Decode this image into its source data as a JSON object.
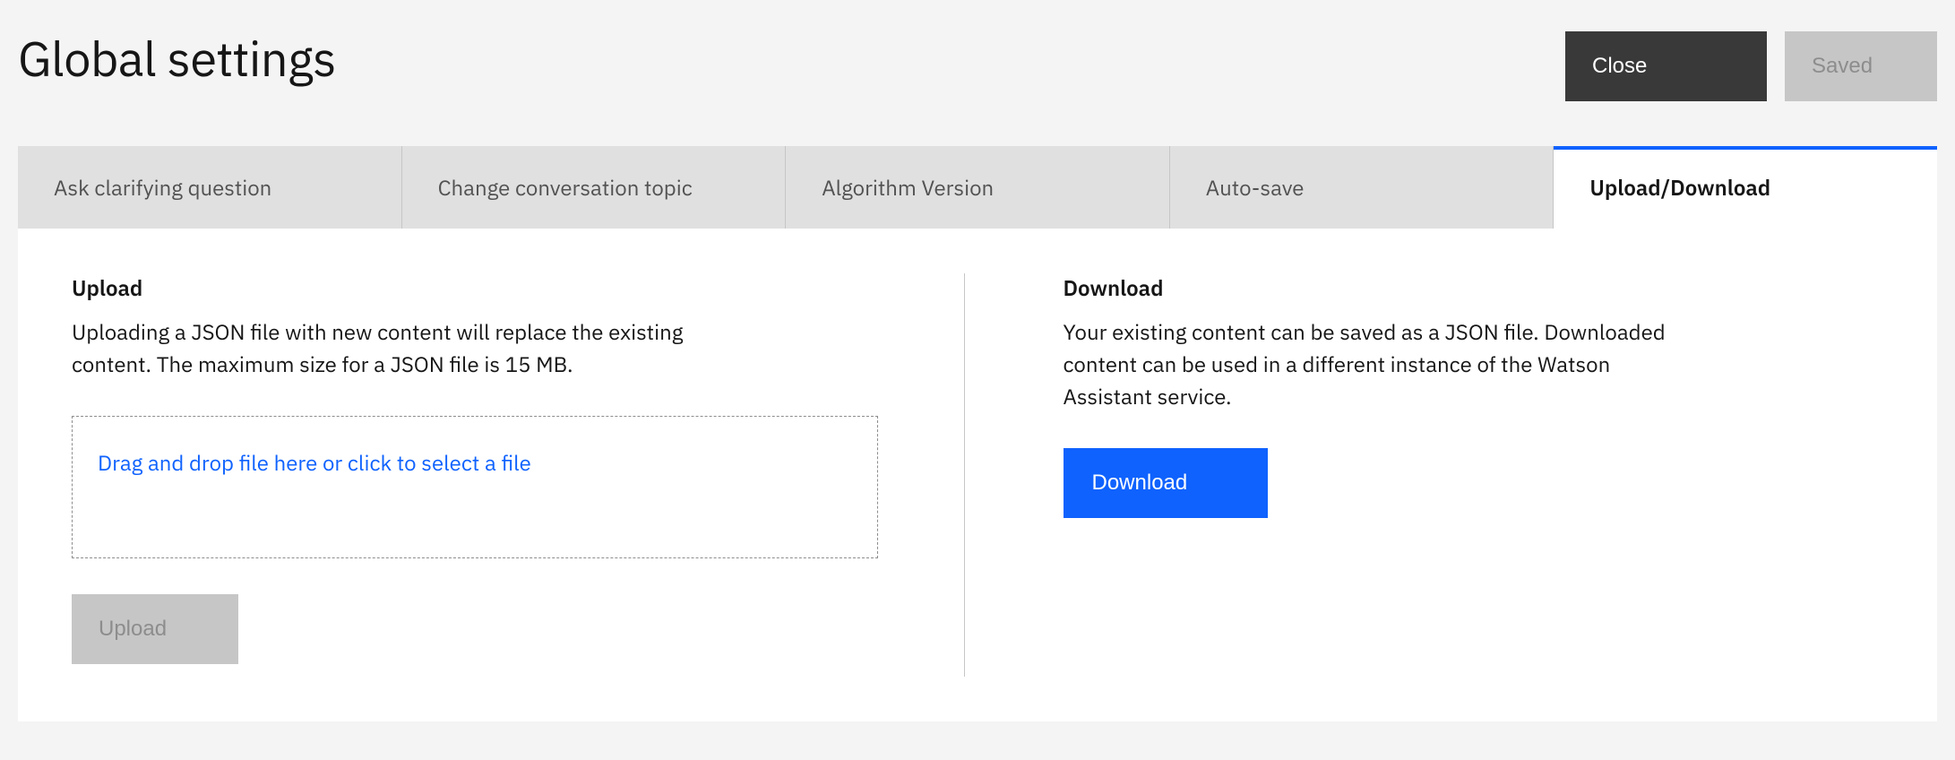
{
  "header": {
    "title": "Global settings",
    "close_label": "Close",
    "saved_label": "Saved"
  },
  "tabs": [
    {
      "label": "Ask clarifying question",
      "active": false
    },
    {
      "label": "Change conversation topic",
      "active": false
    },
    {
      "label": "Algorithm Version",
      "active": false
    },
    {
      "label": "Auto-save",
      "active": false
    },
    {
      "label": "Upload/Download",
      "active": true
    }
  ],
  "upload": {
    "title": "Upload",
    "description": "Uploading a JSON file with new content will replace the existing content. The maximum size for a JSON file is 15 MB.",
    "dropzone_text": "Drag and drop file here or click to select a file",
    "button_label": "Upload"
  },
  "download": {
    "title": "Download",
    "description": "Your existing content can be saved as a JSON file. Downloaded content can be used in a different instance of the Watson Assistant service.",
    "button_label": "Download"
  }
}
